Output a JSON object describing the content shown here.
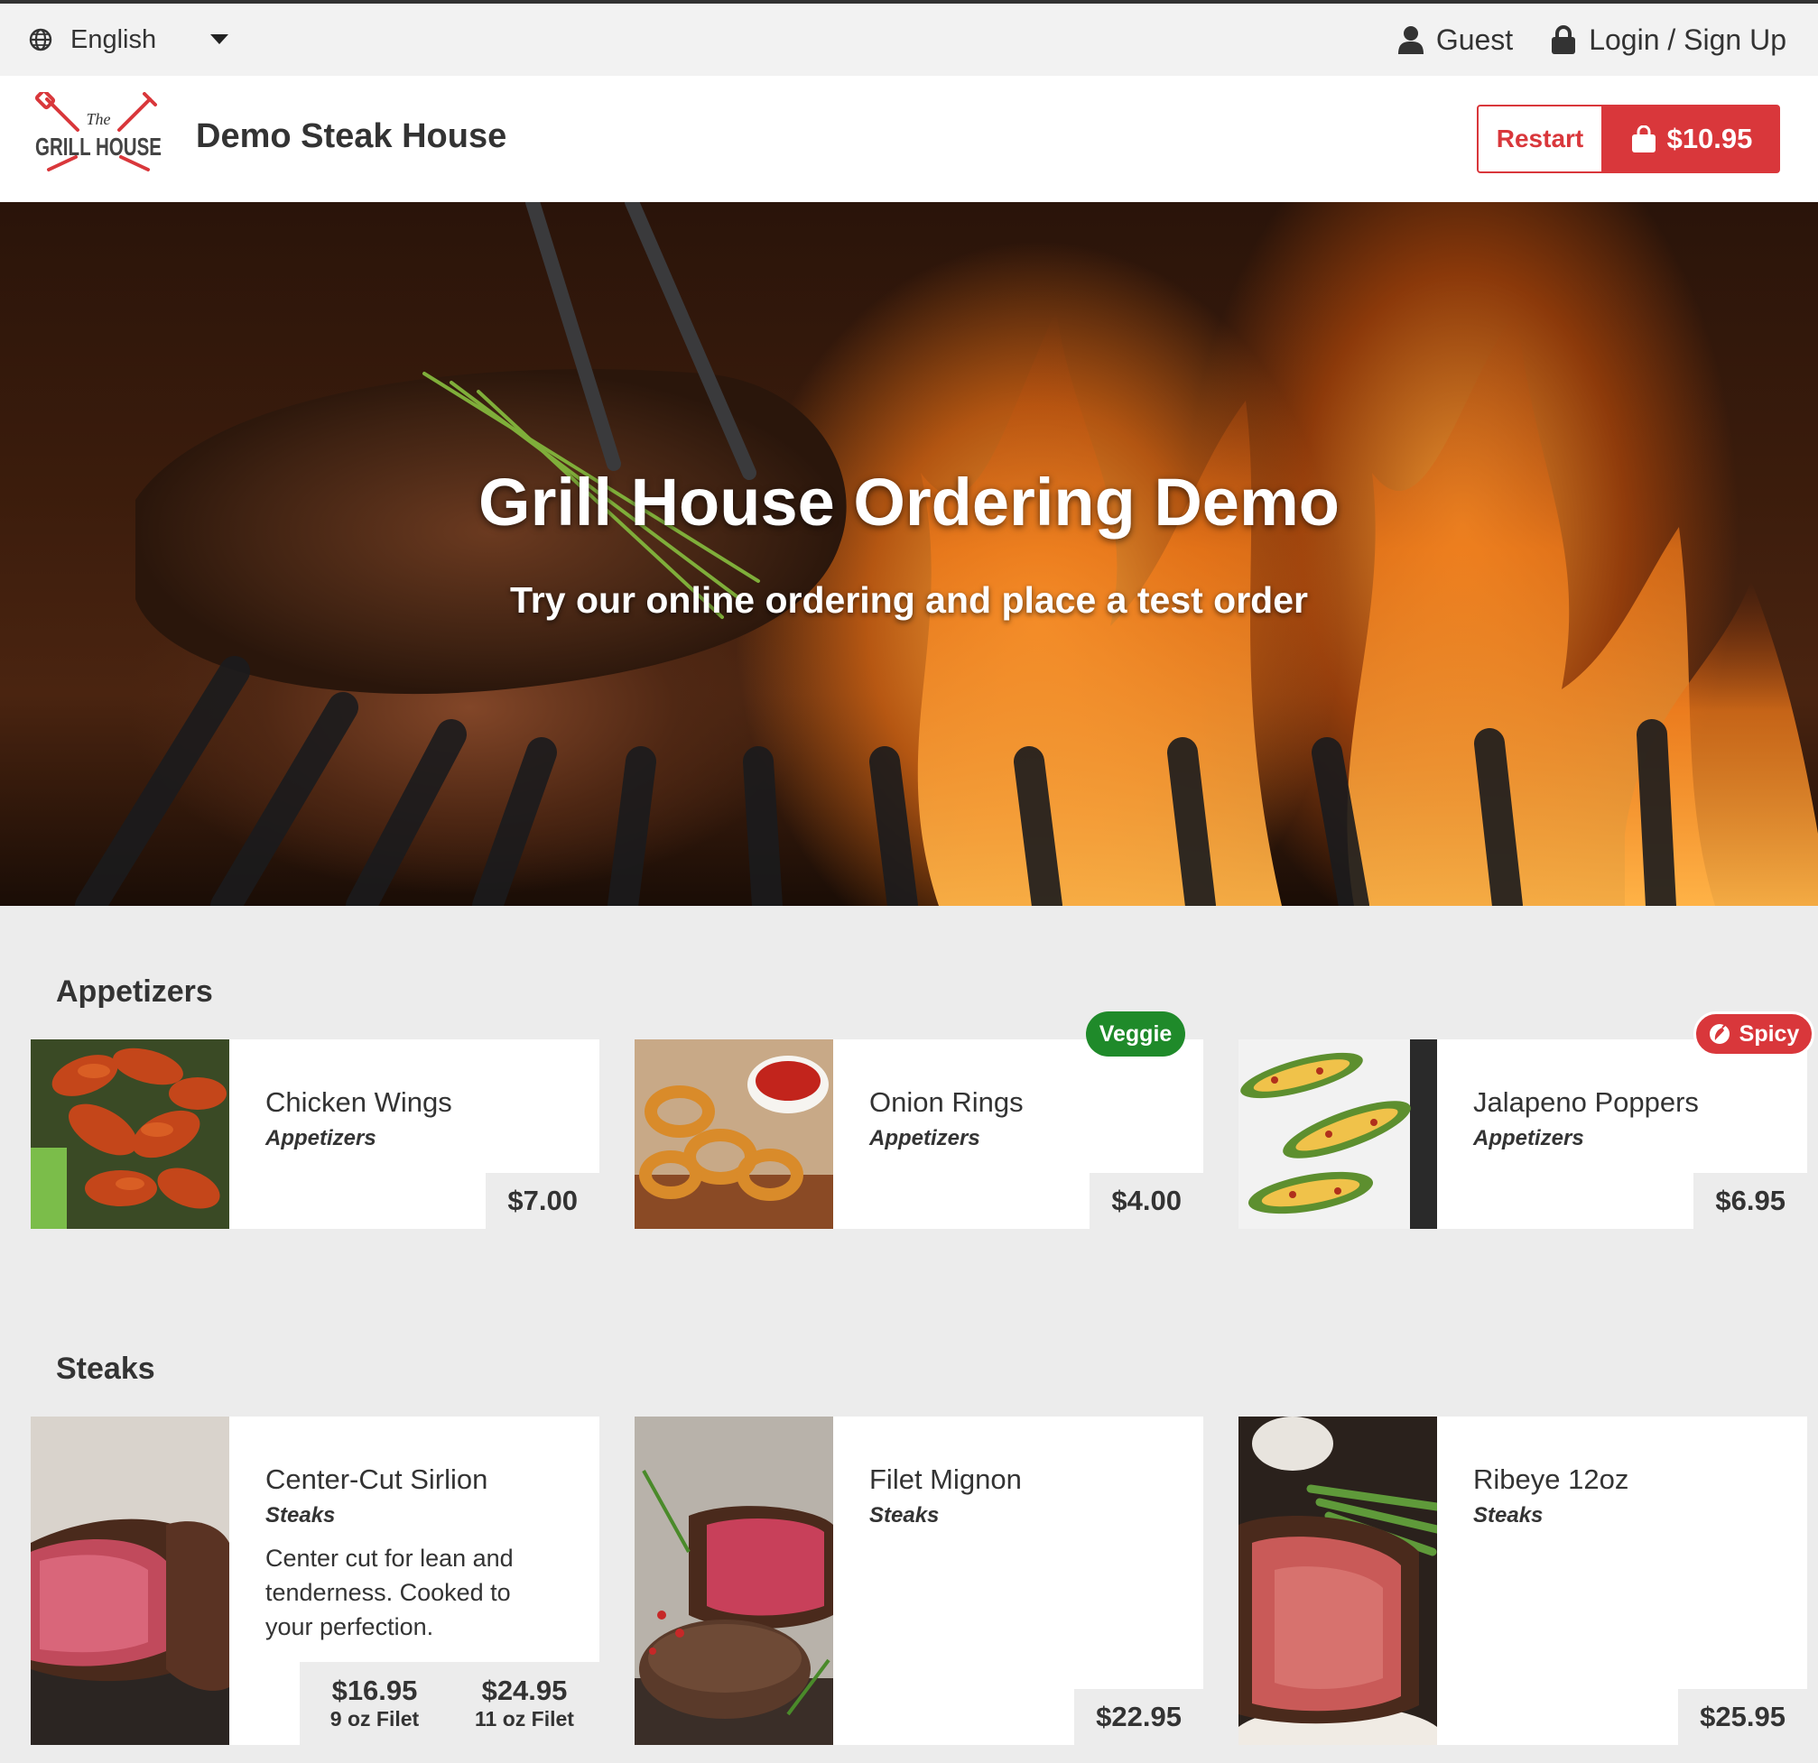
{
  "topbar": {
    "language": "English",
    "guest_label": "Guest",
    "login_label": "Login / Sign Up"
  },
  "header": {
    "logo_text_top": "The",
    "logo_text_main": "GRILL HOUSE",
    "restaurant_name": "Demo Steak House",
    "restart_label": "Restart",
    "cart_total": "$10.95"
  },
  "hero": {
    "title": "Grill House Ordering Demo",
    "subtitle": "Try our online ordering and place a test order"
  },
  "sections": [
    {
      "title": "Appetizers",
      "items": [
        {
          "name": "Chicken Wings",
          "category": "Appetizers",
          "price": "$7.00"
        },
        {
          "name": "Onion Rings",
          "category": "Appetizers",
          "price": "$4.00",
          "badge": "Veggie"
        },
        {
          "name": "Jalapeno Poppers",
          "category": "Appetizers",
          "price": "$6.95",
          "badge": "Spicy"
        }
      ]
    },
    {
      "title": "Steaks",
      "items": [
        {
          "name": "Center-Cut Sirlion",
          "category": "Steaks",
          "description": "Center cut for lean and tenderness. Cooked to your perfection.",
          "prices": [
            {
              "price": "$16.95",
              "label": "9 oz Filet"
            },
            {
              "price": "$24.95",
              "label": "11 oz Filet"
            }
          ]
        },
        {
          "name": "Filet Mignon",
          "category": "Steaks",
          "price": "$22.95"
        },
        {
          "name": "Ribeye 12oz",
          "category": "Steaks",
          "price": "$25.95"
        }
      ]
    }
  ],
  "colors": {
    "accent": "#d9373b",
    "veggie": "#1f8a2a",
    "page_bg": "#ececec"
  }
}
